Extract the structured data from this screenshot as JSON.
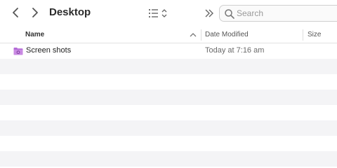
{
  "window": {
    "title": "Desktop"
  },
  "toolbar": {
    "back_icon": "chevron-left-icon",
    "forward_icon": "chevron-right-icon",
    "view_icon": "list-view-icon",
    "more_icon": "double-chevron-right-icon"
  },
  "search": {
    "placeholder": "Search",
    "value": "",
    "icon": "search-icon"
  },
  "columns": {
    "name": "Name",
    "date_modified": "Date Modified",
    "size": "Size",
    "sort_direction": "ascending"
  },
  "files": [
    {
      "name": "Screen shots",
      "date_modified": "Today at 7:16 am",
      "icon": "folder-icon",
      "icon_color": "#b46bd6"
    }
  ],
  "colors": {
    "row_alt": "#f4f4f6",
    "header_border": "#e2e2e2"
  }
}
